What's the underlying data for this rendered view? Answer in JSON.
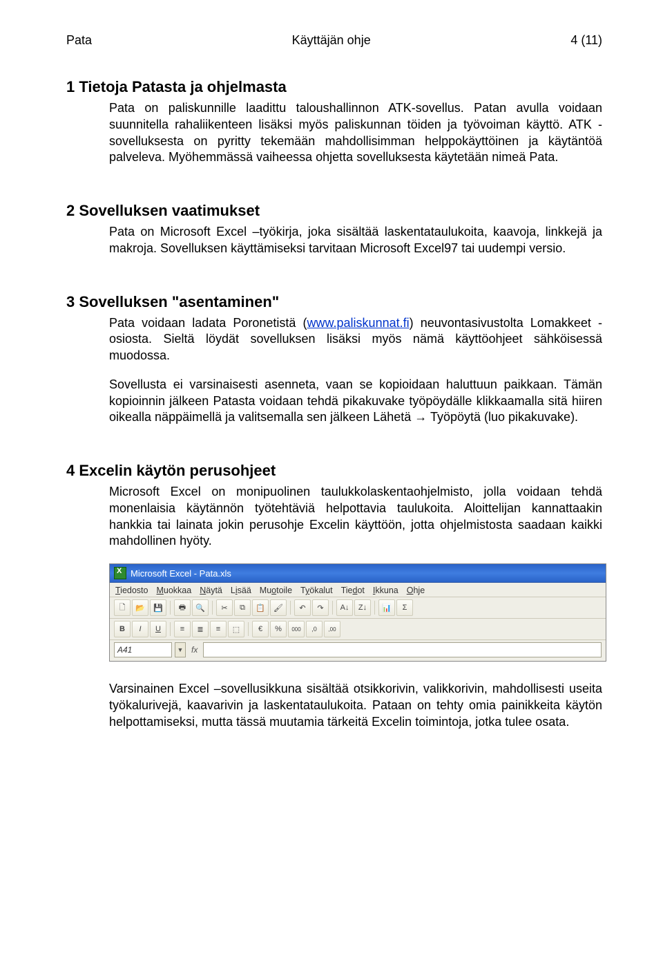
{
  "header": {
    "left": "Pata",
    "center": "Käyttäjän ohje",
    "right": "4 (11)"
  },
  "sections": [
    {
      "heading": "1 Tietoja Patasta ja ohjelmasta",
      "paras": [
        "Pata on paliskunnille laadittu taloushallinnon ATK-sovellus. Patan avulla voidaan suunnitella rahaliikenteen lisäksi myös paliskunnan töiden ja työvoiman käyttö. ATK -sovelluksesta on pyritty tekemään mahdollisimman helppokäyttöinen ja käytäntöä palveleva. Myöhemmässä vaiheessa ohjetta sovelluksesta käytetään nimeä Pata."
      ]
    },
    {
      "heading": "2 Sovelluksen vaatimukset",
      "paras": [
        "Pata on Microsoft Excel –työkirja, joka sisältää laskentataulukoita, kaavoja, linkkejä ja makroja. Sovelluksen käyttämiseksi tarvitaan Microsoft Excel97 tai uudempi versio."
      ]
    },
    {
      "heading": "3 Sovelluksen \"asentaminen\"",
      "para_before_link": "Pata voidaan ladata Poronetistä (",
      "link_text": "www.paliskunnat.fi",
      "para_after_link": ") neuvontasivustolta Lomakkeet -osiosta. Sieltä löydät sovelluksen lisäksi myös nämä käyttöohjeet sähköisessä muodossa.",
      "paras_rest": [
        "Sovellusta ei varsinaisesti asenneta, vaan se kopioidaan haluttuun paikkaan. Tämän kopioinnin jälkeen Patasta voidaan tehdä pikakuvake työpöydälle klikkaamalla sitä hiiren oikealla näppäimellä ja valitsemalla sen jälkeen Lähetä → Työpöytä (luo pikakuvake)."
      ]
    },
    {
      "heading": "4 Excelin käytön perusohjeet",
      "paras": [
        "Microsoft Excel on monipuolinen taulukkolaskentaohjelmisto, jolla voidaan tehdä monenlaisia käytännön työtehtäviä helpottavia taulukoita. Aloittelijan kannattaakin hankkia tai lainata jokin perusohje Excelin käyttöön, jotta ohjelmistosta saadaan kaikki mahdollinen hyöty."
      ],
      "after_image": [
        "Varsinainen Excel –sovellusikkuna sisältää otsikkorivin, valikkorivin, mahdollisesti useita työkalurivejä, kaavarivin ja laskentataulukoita. Pataan on tehty omia painikkeita käytön helpottamiseksi, mutta tässä muutamia tärkeitä Excelin toimintoja, jotka tulee osata."
      ]
    }
  ],
  "excel": {
    "title": "Microsoft Excel - Pata.xls",
    "name_box": "A41",
    "fx": "fx",
    "menu": {
      "m0_pre": "",
      "m0_u": "T",
      "m0_post": "iedosto",
      "m1_pre": "",
      "m1_u": "M",
      "m1_post": "uokkaa",
      "m2_pre": "",
      "m2_u": "N",
      "m2_post": "äytä",
      "m3_pre": "L",
      "m3_u": "i",
      "m3_post": "s",
      "m3_post2": "ää",
      "m4_pre": "Mu",
      "m4_u": "o",
      "m4_post": "toile",
      "m5_pre": "T",
      "m5_u": "y",
      "m5_post": "ökalut",
      "m6_pre": "Tie",
      "m6_u": "d",
      "m6_post": "ot",
      "m7_pre": "",
      "m7_u": "I",
      "m7_post": "kkuna",
      "m8_pre": "",
      "m8_u": "O",
      "m8_post": "hje"
    },
    "icons": {
      "new": "🗋",
      "open": "📂",
      "save": "💾",
      "print": "🖶",
      "preview": "🔍",
      "cut": "✂",
      "copy": "⧉",
      "paste": "📋",
      "brush": "🖌",
      "undo": "↶",
      "redo": "↷",
      "sort_asc": "A↓",
      "sort_desc": "Z↓",
      "chart": "📊",
      "sigma": "Σ",
      "bold": "B",
      "italic": "I",
      "underline": "U",
      "align_l": "≡",
      "align_c": "≣",
      "align_r": "≡",
      "merge": "⬚",
      "currency": "€",
      "percent": "%",
      "comma": "000",
      "dec_inc": ",0",
      "dec_dec": ",00"
    }
  }
}
